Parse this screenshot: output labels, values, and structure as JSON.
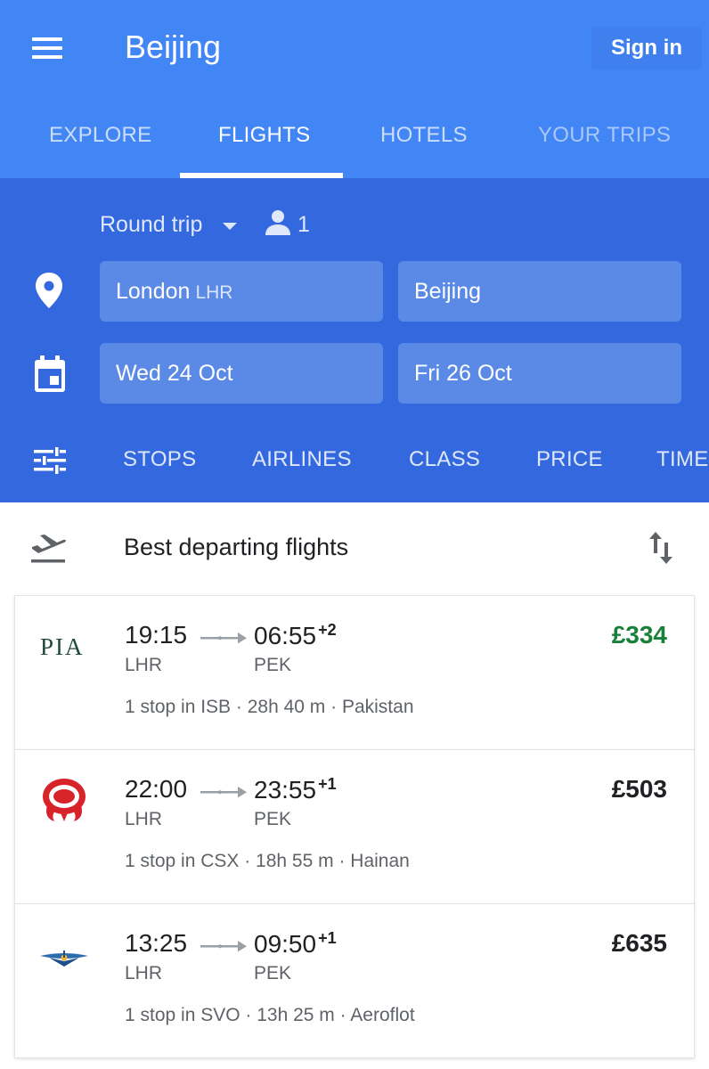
{
  "header": {
    "title": "Beijing",
    "sign_in": "Sign in",
    "tabs": [
      {
        "label": "EXPLORE"
      },
      {
        "label": "FLIGHTS"
      },
      {
        "label": "HOTELS"
      },
      {
        "label": "YOUR TRIPS"
      }
    ],
    "active_tab": "FLIGHTS"
  },
  "search": {
    "trip_type": "Round trip",
    "passengers": "1",
    "origin": {
      "city": "London",
      "code": "LHR"
    },
    "destination": {
      "city": "Beijing"
    },
    "depart_date": "Wed 24 Oct",
    "return_date": "Fri 26 Oct",
    "filters": [
      "STOPS",
      "AIRLINES",
      "CLASS",
      "PRICE",
      "TIME"
    ]
  },
  "results": {
    "title": "Best departing flights",
    "flights": [
      {
        "logo_text": "PIA",
        "depart_time": "19:15",
        "arrive_time": "06:55",
        "day_offset": "+2",
        "from": "LHR",
        "to": "PEK",
        "details": "1 stop in ISB · 28h 40 m · Pakistan",
        "price": "£334",
        "price_color": "#188038"
      },
      {
        "logo_icon": "hainan-logo-icon",
        "depart_time": "22:00",
        "arrive_time": "23:55",
        "day_offset": "+1",
        "from": "LHR",
        "to": "PEK",
        "details": "1 stop in CSX · 18h 55 m · Hainan",
        "price": "£503",
        "price_color": "#202124"
      },
      {
        "logo_icon": "aeroflot-logo-icon",
        "depart_time": "13:25",
        "arrive_time": "09:50",
        "day_offset": "+1",
        "from": "LHR",
        "to": "PEK",
        "details": "1 stop in SVO · 13h 25 m · Aeroflot",
        "price": "£635",
        "price_color": "#202124"
      }
    ]
  },
  "colors": {
    "app_bar": "#4285f4",
    "search_panel": "#3468de",
    "field": "#5b8ae6",
    "best_price": "#188038"
  }
}
